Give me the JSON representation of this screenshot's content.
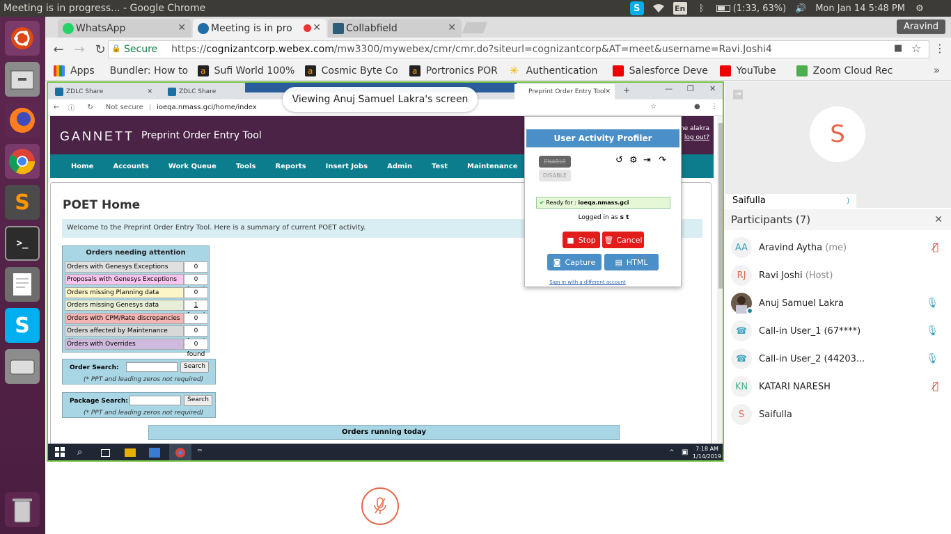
{
  "topbar": {
    "window_title": "Meeting is in progress... - Google Chrome",
    "keyboard": "En",
    "battery": "(1:33, 63%)",
    "clock": "Mon Jan 14  5:48 PM"
  },
  "launcher": {
    "apps": [
      "Ubuntu",
      "Files",
      "Firefox",
      "Chrome",
      "Sublime Text",
      "Terminal",
      "Text Editor",
      "Skype",
      "Drive",
      "Trash"
    ]
  },
  "chrome": {
    "tabs": [
      {
        "label": "WhatsApp"
      },
      {
        "label": "Meeting is in pro"
      },
      {
        "label": "Collabfield"
      }
    ],
    "profile": "Aravind",
    "secure_label": "Secure",
    "url_prefix": "https://",
    "url_host": "cognizantcorp.webex.com",
    "url_path": "/mw3300/mywebex/cmr/cmr.do?siteurl=cognizantcorp&AT=meet&username=Ravi.Joshi4",
    "bookmarks": [
      {
        "label": "Apps"
      },
      {
        "label": "Bundler: How to"
      },
      {
        "label": "Sufi World 100%"
      },
      {
        "label": "Cosmic Byte Co"
      },
      {
        "label": "Portronics POR"
      },
      {
        "label": "Authentication"
      },
      {
        "label": "Salesforce Deve"
      },
      {
        "label": "YouTube"
      },
      {
        "label": "Zoom Cloud Rec"
      }
    ]
  },
  "shared": {
    "banner": "Viewing Anuj Samuel Lakra's screen",
    "inner_tabs": [
      "ZDLC Share",
      "ZDLC Share",
      "Preprint Order Entry Tool"
    ],
    "not_secure": "Not secure",
    "inner_url": "ioeqa.nmass.gci/home/index",
    "header_logo": "GANNETT",
    "header_app": "Preprint Order Entry Tool",
    "header_user": "me alakra",
    "header_logout": "log out?",
    "nav": [
      "Home",
      "Accounts",
      "Work Queue",
      "Tools",
      "Reports",
      "Insert Jobs",
      "Admin",
      "Test",
      "Maintenance"
    ],
    "page_title": "POET Home",
    "welcome": "Welcome to the Preprint Order Entry Tool.  Here is a summary of current POET activity.",
    "orders_header": "Orders needing attention",
    "orders": [
      {
        "label": "Orders with Genesys Exceptions",
        "count": "0 found",
        "bg": "#e0e0e0"
      },
      {
        "label": "Proposals with Genesys Exceptions",
        "count": "0 found",
        "bg": "#f8c4f0"
      },
      {
        "label": "Orders missing Planning data",
        "count": "0 found",
        "bg": "#fbf5c8"
      },
      {
        "label": "Orders missing Genesys data",
        "count": "1 found",
        "bg": "#e6eed6"
      },
      {
        "label": "Orders with CPM/Rate discrepancies",
        "count": "0 found",
        "bg": "#f5b5b5"
      },
      {
        "label": "Orders affected by Maintenance Change",
        "count": "0 found",
        "bg": "#d8d8d8"
      },
      {
        "label": "Orders with Overrides",
        "count": "0 found",
        "bg": "#cfb9dc"
      }
    ],
    "order_search_label": "Order Search:",
    "package_search_label": "Package Search:",
    "search_button": "Search",
    "search_note": "(* PPT and leading zeros not required)",
    "running_header": "Orders running today",
    "profiler": {
      "title": "User Activity Profiler",
      "enable": "ENABLE",
      "disable": "DISABLE",
      "ready_prefix": "Ready for :",
      "ready_host": "ioeqa.nmass.gci",
      "logged_prefix": "Logged in as",
      "logged_user": "s t",
      "stop": "Stop",
      "cancel": "Cancel",
      "capture": "Capture",
      "html": "HTML",
      "signin": "Sign in with a different account"
    },
    "clock_time": "7:18 AM",
    "clock_date": "1/14/2019"
  },
  "webex": {
    "video_initial": "S",
    "video_name": "Saifulla",
    "participants_title": "Participants (7)",
    "participants": [
      {
        "initials": "AA",
        "name": "Aravind Aytha",
        "role": "(me)",
        "color": "#3aa3c2",
        "mic": "muted"
      },
      {
        "initials": "RJ",
        "name": "Ravi Joshi",
        "role": "(Host)",
        "color": "#e8664a",
        "mic": "none"
      },
      {
        "initials": "",
        "name": "Anuj Samuel Lakra",
        "role": "",
        "color": "#444444",
        "mic": "on"
      },
      {
        "initials": "☎",
        "name": "Call-in User_1 (67****)",
        "role": "",
        "color": "#3aa3c2",
        "mic": "on"
      },
      {
        "initials": "☎",
        "name": "Call-in User_2 (44203...",
        "role": "",
        "color": "#3aa3c2",
        "mic": "on"
      },
      {
        "initials": "KN",
        "name": "KATARI NARESH",
        "role": "",
        "color": "#46b38a",
        "mic": "muted"
      },
      {
        "initials": "S",
        "name": "Saifulla",
        "role": "",
        "color": "#e8664a",
        "mic": "none"
      }
    ]
  }
}
